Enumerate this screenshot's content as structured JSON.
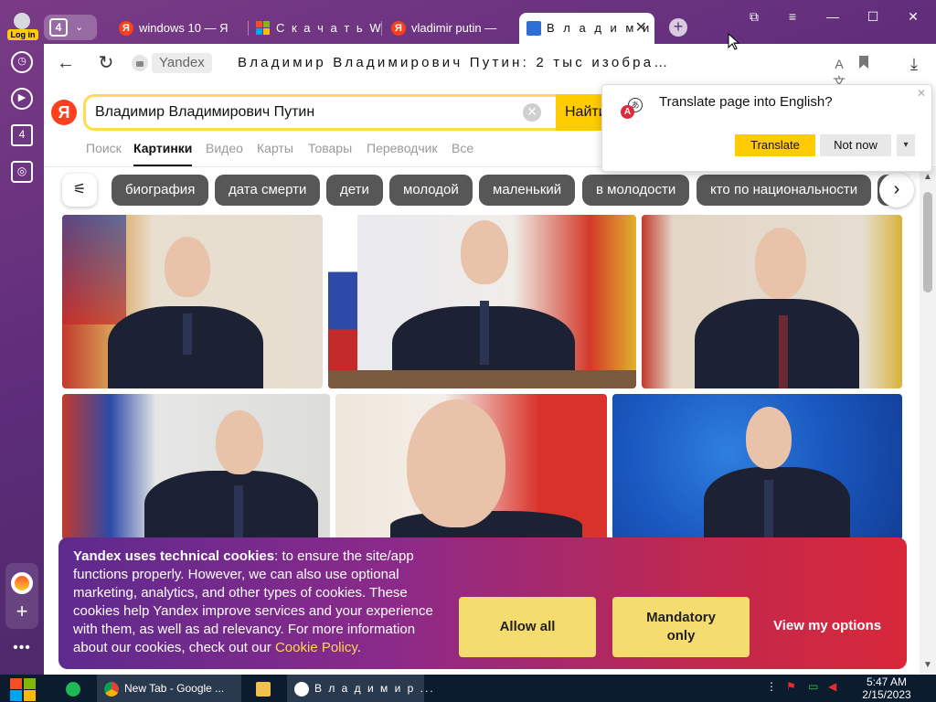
{
  "sidebar": {
    "login_label": "Log in",
    "items": [
      {
        "icon": "history-icon",
        "glyph": "◷"
      },
      {
        "icon": "play-icon",
        "glyph": "▷"
      },
      {
        "icon": "tab-count-icon",
        "glyph": "4"
      },
      {
        "icon": "screenshot-icon",
        "glyph": "◫"
      }
    ],
    "more_glyph": "•••",
    "add_glyph": "+"
  },
  "tabs": {
    "count": "4",
    "items": [
      {
        "title": "windows 10 — Я",
        "favicon": "Я"
      },
      {
        "title": "С к а ч а т ь  W",
        "favicon": "ms"
      },
      {
        "title": "vladimir putin —",
        "favicon": "Я"
      },
      {
        "title": "В л а д и м и",
        "favicon": "image",
        "active": true
      }
    ],
    "close_glyph": "✕"
  },
  "window_controls": {
    "pin": "⧉",
    "menu": "≡",
    "minimize": "—",
    "maximize": "☐",
    "close": "✕"
  },
  "address_bar": {
    "domain": "Yandex",
    "page_title": "Владимир Владимирович Путин: 2 тыс изобра…"
  },
  "search": {
    "query": "Владимир Владимирович Путин",
    "button_label": "Найти",
    "logo": "Я",
    "tabs": [
      "Поиск",
      "Картинки",
      "Видео",
      "Карты",
      "Товары",
      "Переводчик",
      "Все"
    ],
    "active_tab": "Картинки"
  },
  "chips": [
    "биография",
    "дата смерти",
    "дети",
    "молодой",
    "маленький",
    "в молодости",
    "кто по национальности"
  ],
  "translate_popup": {
    "title": "Translate page into English?",
    "translate_label": "Translate",
    "not_now_label": "Not now"
  },
  "cookie_banner": {
    "bold": "Yandex uses technical cookies",
    "text": ": to ensure the site/app functions properly. However, we can also use optional marketing, analytics, and other types of cookies. These cookies help Yandex improve services and your experience with them, as well as ad relevancy. For more information about our cookies, check out our ",
    "link": "Cookie Policy",
    "end": ".",
    "allow_all": "Allow all",
    "mandatory_only": "Mandatory only",
    "view_options": "View my options"
  },
  "taskbar": {
    "apps": [
      {
        "label": "New Tab - Google ..."
      },
      {
        "label": "В л а д и м и р ..."
      }
    ],
    "time": "5:47 AM",
    "date": "2/15/2023"
  },
  "colors": {
    "yandex_red": "#fc3f1d",
    "yandex_yellow": "#ffcc00",
    "chip": "#575757"
  }
}
